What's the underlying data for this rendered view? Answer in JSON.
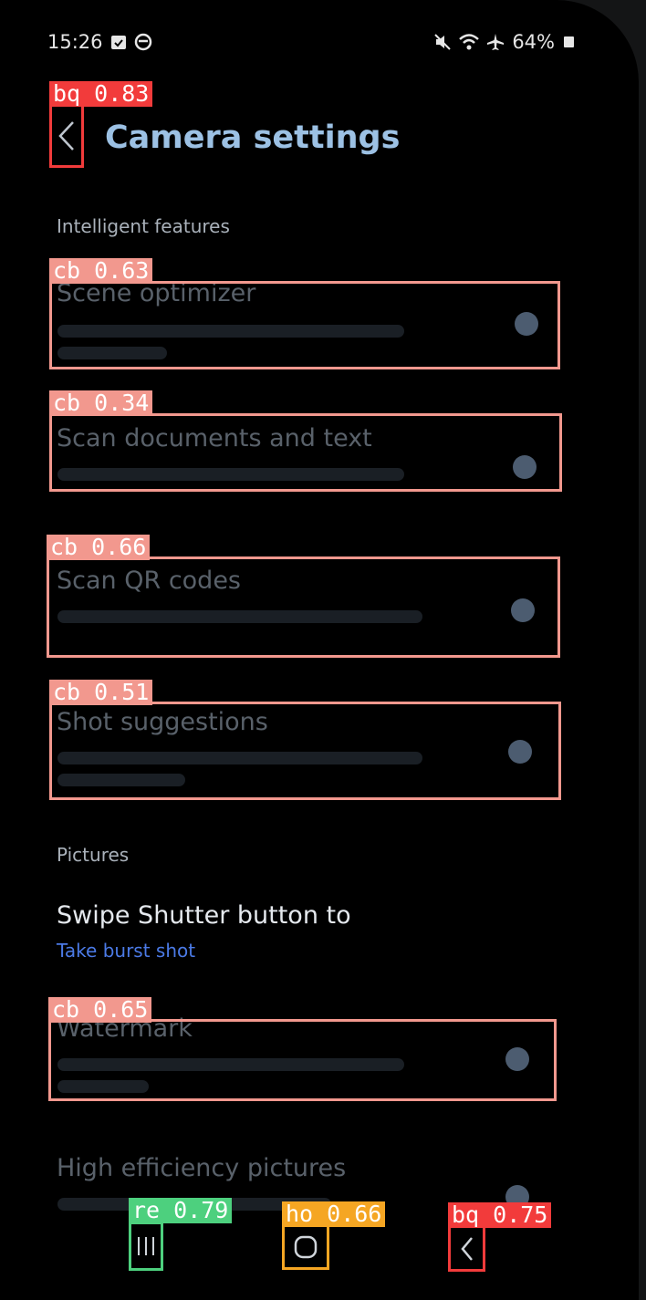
{
  "status": {
    "time": "15:26",
    "battery": "64%"
  },
  "header": {
    "title": "Camera settings"
  },
  "sections": {
    "intelligent": "Intelligent features",
    "pictures": "Pictures"
  },
  "items": {
    "scene": "Scene optimizer",
    "scan_docs": "Scan documents and text",
    "scan_qr": "Scan QR codes",
    "shot": "Shot suggestions",
    "swipe": "Swipe Shutter button to",
    "swipe_value": "Take burst shot",
    "watermark": "Watermark",
    "hep": "High efficiency pictures"
  },
  "detections": {
    "back_top": "bq 0.83",
    "cb_scene": "cb 0.63",
    "cb_scan_docs": "cb 0.34",
    "cb_scan_qr": "cb 0.66",
    "cb_shot": "cb 0.51",
    "cb_watermark": "cb 0.65",
    "recents": "re 0.79",
    "home": "ho 0.66",
    "back_nav": "bq 0.75"
  },
  "colors": {
    "title": "#9cc1e4",
    "accent_blue": "#4b7ae6",
    "det_cb": "#f2988e",
    "det_back": "#f23b3b",
    "det_recents": "#4dd07e",
    "det_home": "#f5a623"
  }
}
